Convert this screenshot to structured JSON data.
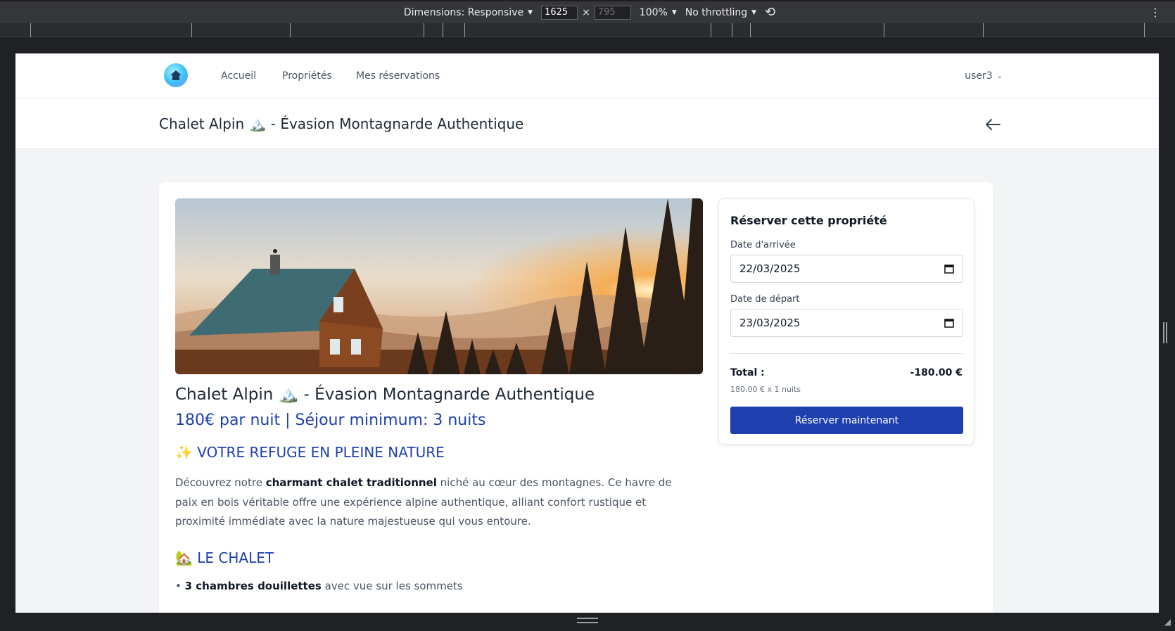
{
  "devtools": {
    "dimensions_label": "Dimensions: Responsive",
    "width_value": "1625",
    "times": "×",
    "height_value": "795",
    "zoom": "100%",
    "throttling": "No throttling"
  },
  "nav": {
    "links": [
      "Accueil",
      "Propriétés",
      "Mes réservations"
    ],
    "user": "user3"
  },
  "header": {
    "title": "Chalet Alpin 🏔️ - Évasion Montagnarde Authentique"
  },
  "property": {
    "title": "Chalet Alpin 🏔️ - Évasion Montagnarde Authentique",
    "price_line": "180€ par nuit | Séjour minimum: 3 nuits",
    "section1": "✨ VOTRE REFUGE EN PLEINE NATURE",
    "desc_before": "Découvrez notre ",
    "desc_bold": "charmant chalet traditionnel",
    "desc_after": " niché au cœur des montagnes. Ce havre de paix en bois véritable offre une expérience alpine authentique, alliant confort rustique et proximité immédiate avec la nature majestueuse qui vous entoure.",
    "section2": "🏡 LE CHALET",
    "bullet_bold": "3 chambres douillettes",
    "bullet_rest": " avec vue sur les sommets"
  },
  "booking": {
    "heading": "Réserver cette propriété",
    "arrival_label": "Date d'arrivée",
    "arrival_value": "22/03/2025",
    "departure_label": "Date de départ",
    "departure_value": "23/03/2025",
    "total_label": "Total :",
    "total_value": "-180.00 €",
    "breakdown": "180.00 € x 1 nuits",
    "button": "Réserver maintenant"
  }
}
